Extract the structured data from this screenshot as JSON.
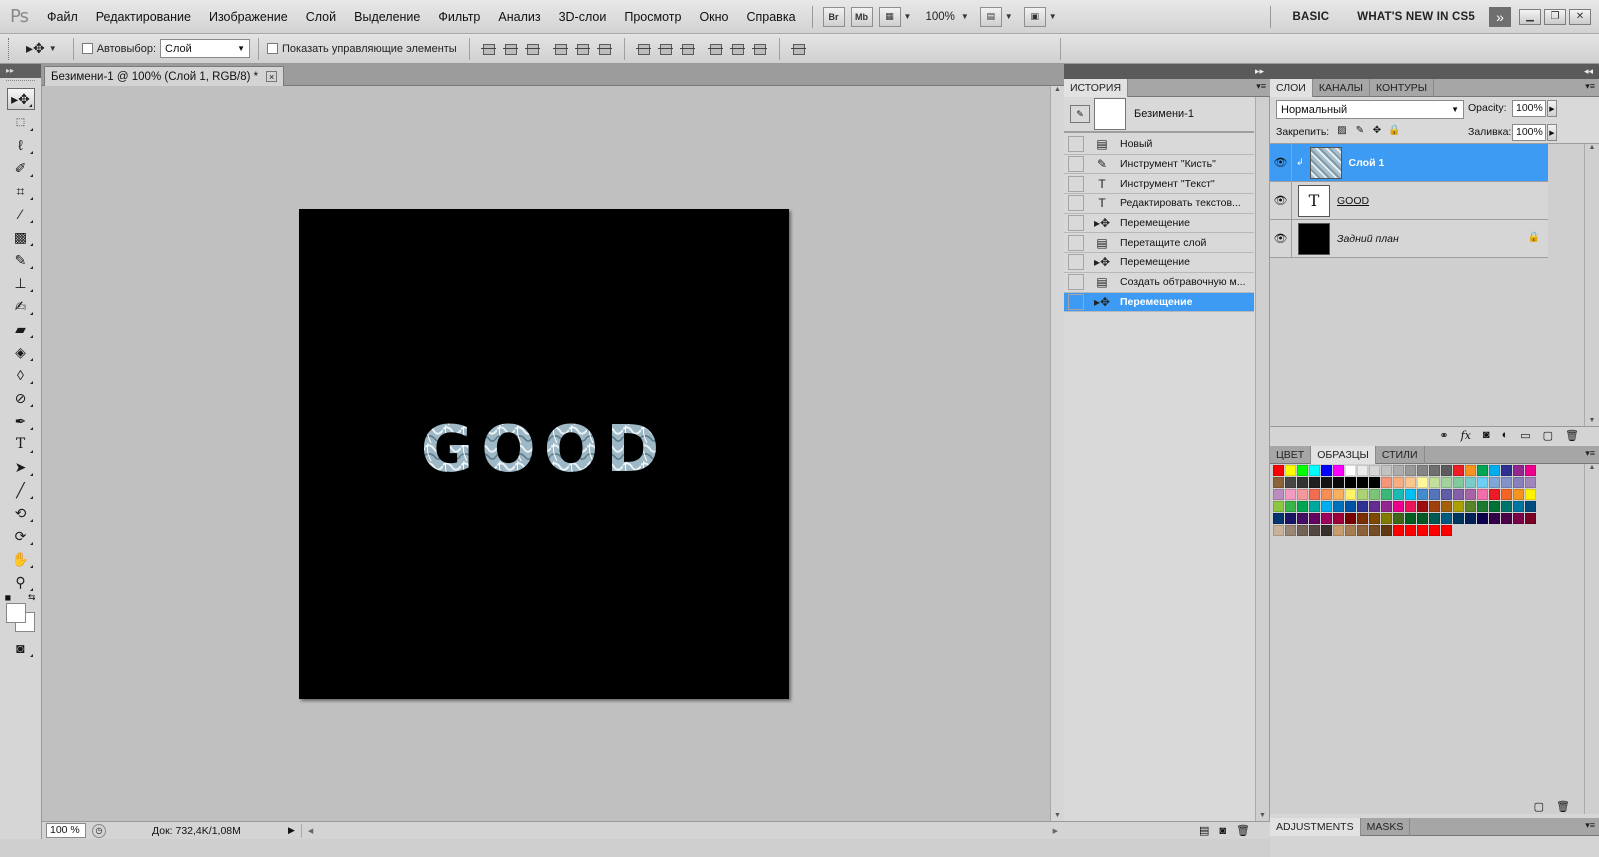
{
  "app": {
    "logo": "Ps"
  },
  "menu": {
    "items": [
      "Файл",
      "Редактирование",
      "Изображение",
      "Слой",
      "Выделение",
      "Фильтр",
      "Анализ",
      "3D-слои",
      "Просмотр",
      "Окно",
      "Справка"
    ],
    "bridge_label": "Br",
    "minibridge_label": "Mb",
    "zoom": "100%",
    "workspaces": [
      "BASIC",
      "WHAT'S NEW IN CS5"
    ],
    "more_label": "»"
  },
  "options": {
    "autoselect_label": "Автовыбор:",
    "autoselect_value": "Слой",
    "show_controls_label": "Показать управляющие элементы"
  },
  "document": {
    "tab_title": "Безимени-1 @ 100% (Слой 1, RGB/8) *",
    "close_label": "×",
    "text": "GOOD",
    "text_fill": "#9fb8c6"
  },
  "status": {
    "zoom": "100 %",
    "doc_info": "Док: 732,4K/1,08M"
  },
  "history": {
    "tab": "ИСТОРИЯ",
    "snapshot_name": "Безимени-1",
    "items": [
      {
        "icon": "▤",
        "label": "Новый"
      },
      {
        "icon": "✎",
        "label": "Инструмент \"Кисть\""
      },
      {
        "icon": "T",
        "label": "Инструмент \"Текст\""
      },
      {
        "icon": "T",
        "label": "Редактировать текстов..."
      },
      {
        "icon": "▸✥",
        "label": "Перемещение"
      },
      {
        "icon": "▤",
        "label": "Перетащите слой"
      },
      {
        "icon": "▸✥",
        "label": "Перемещение"
      },
      {
        "icon": "▤",
        "label": "Создать обтравочную м..."
      },
      {
        "icon": "▸✥",
        "label": "Перемещение"
      }
    ],
    "active_index": 8
  },
  "layers": {
    "tabs": [
      "СЛОИ",
      "КАНАЛЫ",
      "КОНТУРЫ"
    ],
    "blend_mode": "Нормальный",
    "opacity_label": "Opacity:",
    "opacity": "100%",
    "lock_label": "Закрепить:",
    "fill_label": "Заливка:",
    "fill": "100%",
    "items": [
      {
        "name": "Слой 1",
        "thumb": "texture"
      },
      {
        "name": "GOOD",
        "thumb": "T"
      },
      {
        "name": "Задний план",
        "thumb": "black"
      }
    ],
    "active_index": 0
  },
  "swatches": {
    "tabs": [
      "ЦВЕТ",
      "ОБРАЗЦЫ",
      "СТИЛИ"
    ],
    "colors": [
      "#ff0000",
      "#ffff00",
      "#00ff00",
      "#00ffff",
      "#0000ff",
      "#ff00ff",
      "#ffffff",
      "#ebebeb",
      "#d6d6d6",
      "#c2c2c2",
      "#adadad",
      "#999999",
      "#858585",
      "#707070",
      "#5c5c5c",
      "#ee1d24",
      "#f7941d",
      "#00a651",
      "#00aeef",
      "#2e3192",
      "#92278f",
      "#ec008c",
      "#8c6239",
      "#474747",
      "#333333",
      "#1f1f1f",
      "#141414",
      "#0a0a0a",
      "#000000",
      "#000000",
      "#000000",
      "#f69679",
      "#f9ad81",
      "#fdc68a",
      "#fff79a",
      "#c4df9b",
      "#a2d39c",
      "#82ca9d",
      "#7accc8",
      "#6dcff6",
      "#7ea7d8",
      "#8393ca",
      "#8781bd",
      "#a186be",
      "#bd8cbf",
      "#f49ac1",
      "#f5989d",
      "#f26c4f",
      "#f68e55",
      "#fbaf5c",
      "#fff467",
      "#acd372",
      "#7cc576",
      "#3bb878",
      "#1abbb4",
      "#00bff3",
      "#438ccb",
      "#5574b9",
      "#605ca8",
      "#855fa8",
      "#a763a8",
      "#f06ea9",
      "#ed1c24",
      "#f26522",
      "#f7941d",
      "#fff200",
      "#8dc73f",
      "#39b54a",
      "#00a651",
      "#00a99d",
      "#00aeef",
      "#0072bc",
      "#0054a6",
      "#2e3192",
      "#662d91",
      "#92278f",
      "#ec008c",
      "#ed145b",
      "#9e0b0f",
      "#a0410d",
      "#a36209",
      "#aba000",
      "#598527",
      "#1a7b30",
      "#007236",
      "#00746b",
      "#0076a3",
      "#004b80",
      "#003471",
      "#1b1464",
      "#440e62",
      "#630460",
      "#9e005d",
      "#9e0039",
      "#790000",
      "#7b2e00",
      "#7d4900",
      "#827b00",
      "#406618",
      "#005e20",
      "#005826",
      "#005952",
      "#005b7f",
      "#003663",
      "#002157",
      "#0d004c",
      "#32004b",
      "#4b0049",
      "#7b0046",
      "#7a0026",
      "#c7b299",
      "#998675",
      "#736357",
      "#534741",
      "#37302d",
      "#c69c6d",
      "#a67c52",
      "#8c6239",
      "#754c24",
      "#603913",
      "#ff0000",
      "#ff0000",
      "#ff0000",
      "#ff0000",
      "#ff0000"
    ]
  },
  "adjustments": {
    "tabs": [
      "ADJUSTMENTS",
      "MASKS"
    ]
  },
  "colors": {
    "selection": "#3d9bf4",
    "panel_header": "#5a5a5a",
    "canvas_bg": "#c0c0c0"
  }
}
